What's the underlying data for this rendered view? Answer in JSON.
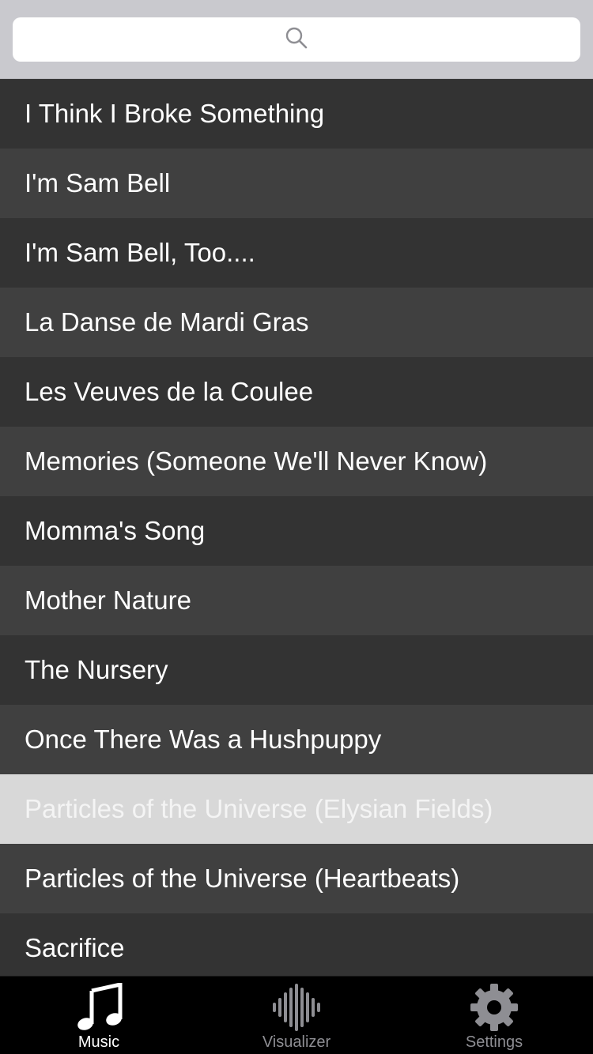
{
  "search": {
    "placeholder": "",
    "icon": "search-icon"
  },
  "songs": [
    {
      "title": "I Think I Broke Something"
    },
    {
      "title": "I'm Sam Bell"
    },
    {
      "title": "I'm Sam Bell, Too...."
    },
    {
      "title": "La Danse de Mardi Gras"
    },
    {
      "title": "Les Veuves de la Coulee"
    },
    {
      "title": "Memories (Someone We'll Never Know)"
    },
    {
      "title": "Momma's Song"
    },
    {
      "title": "Mother Nature"
    },
    {
      "title": "The Nursery"
    },
    {
      "title": "Once There Was a Hushpuppy"
    },
    {
      "title": "Particles of the Universe (Elysian Fields)"
    },
    {
      "title": "Particles of the Universe (Heartbeats)"
    },
    {
      "title": "Sacrifice"
    }
  ],
  "selected_index": 10,
  "tabbar": {
    "tabs": [
      {
        "label": "Music",
        "icon": "music-note-icon",
        "active": true
      },
      {
        "label": "Visualizer",
        "icon": "waveform-icon",
        "active": false
      },
      {
        "label": "Settings",
        "icon": "gear-icon",
        "active": false
      }
    ]
  },
  "colors": {
    "row_dark": "#333333",
    "row_light": "#404040",
    "row_selected": "#d8d8d8",
    "tab_active": "#ffffff",
    "tab_inactive": "#8e8e93"
  }
}
